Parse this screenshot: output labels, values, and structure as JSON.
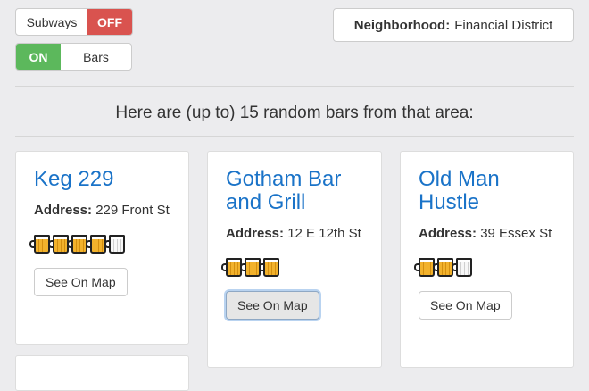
{
  "toggles": {
    "subways": {
      "label": "Subways",
      "state": "OFF"
    },
    "bars": {
      "state": "ON",
      "label": "Bars"
    }
  },
  "neighborhood": {
    "label": "Neighborhood:",
    "value": "Financial District"
  },
  "heading": "Here are (up to) 15 random bars from that area:",
  "cards": [
    {
      "name": "Keg 229",
      "address_label": "Address:",
      "address": "229 Front St",
      "rating": 4.5,
      "button": "See On Map"
    },
    {
      "name": "Gotham Bar and Grill",
      "address_label": "Address:",
      "address": "12 E 12th St",
      "rating": 3,
      "button": "See On Map"
    },
    {
      "name": "Old Man Hustle",
      "address_label": "Address:",
      "address": "39 Essex St",
      "rating": 2.5,
      "button": "See On Map"
    }
  ],
  "colors": {
    "off": "#d9534f",
    "on": "#5cb85c",
    "link": "#1a73c8",
    "background": "#ececee"
  }
}
